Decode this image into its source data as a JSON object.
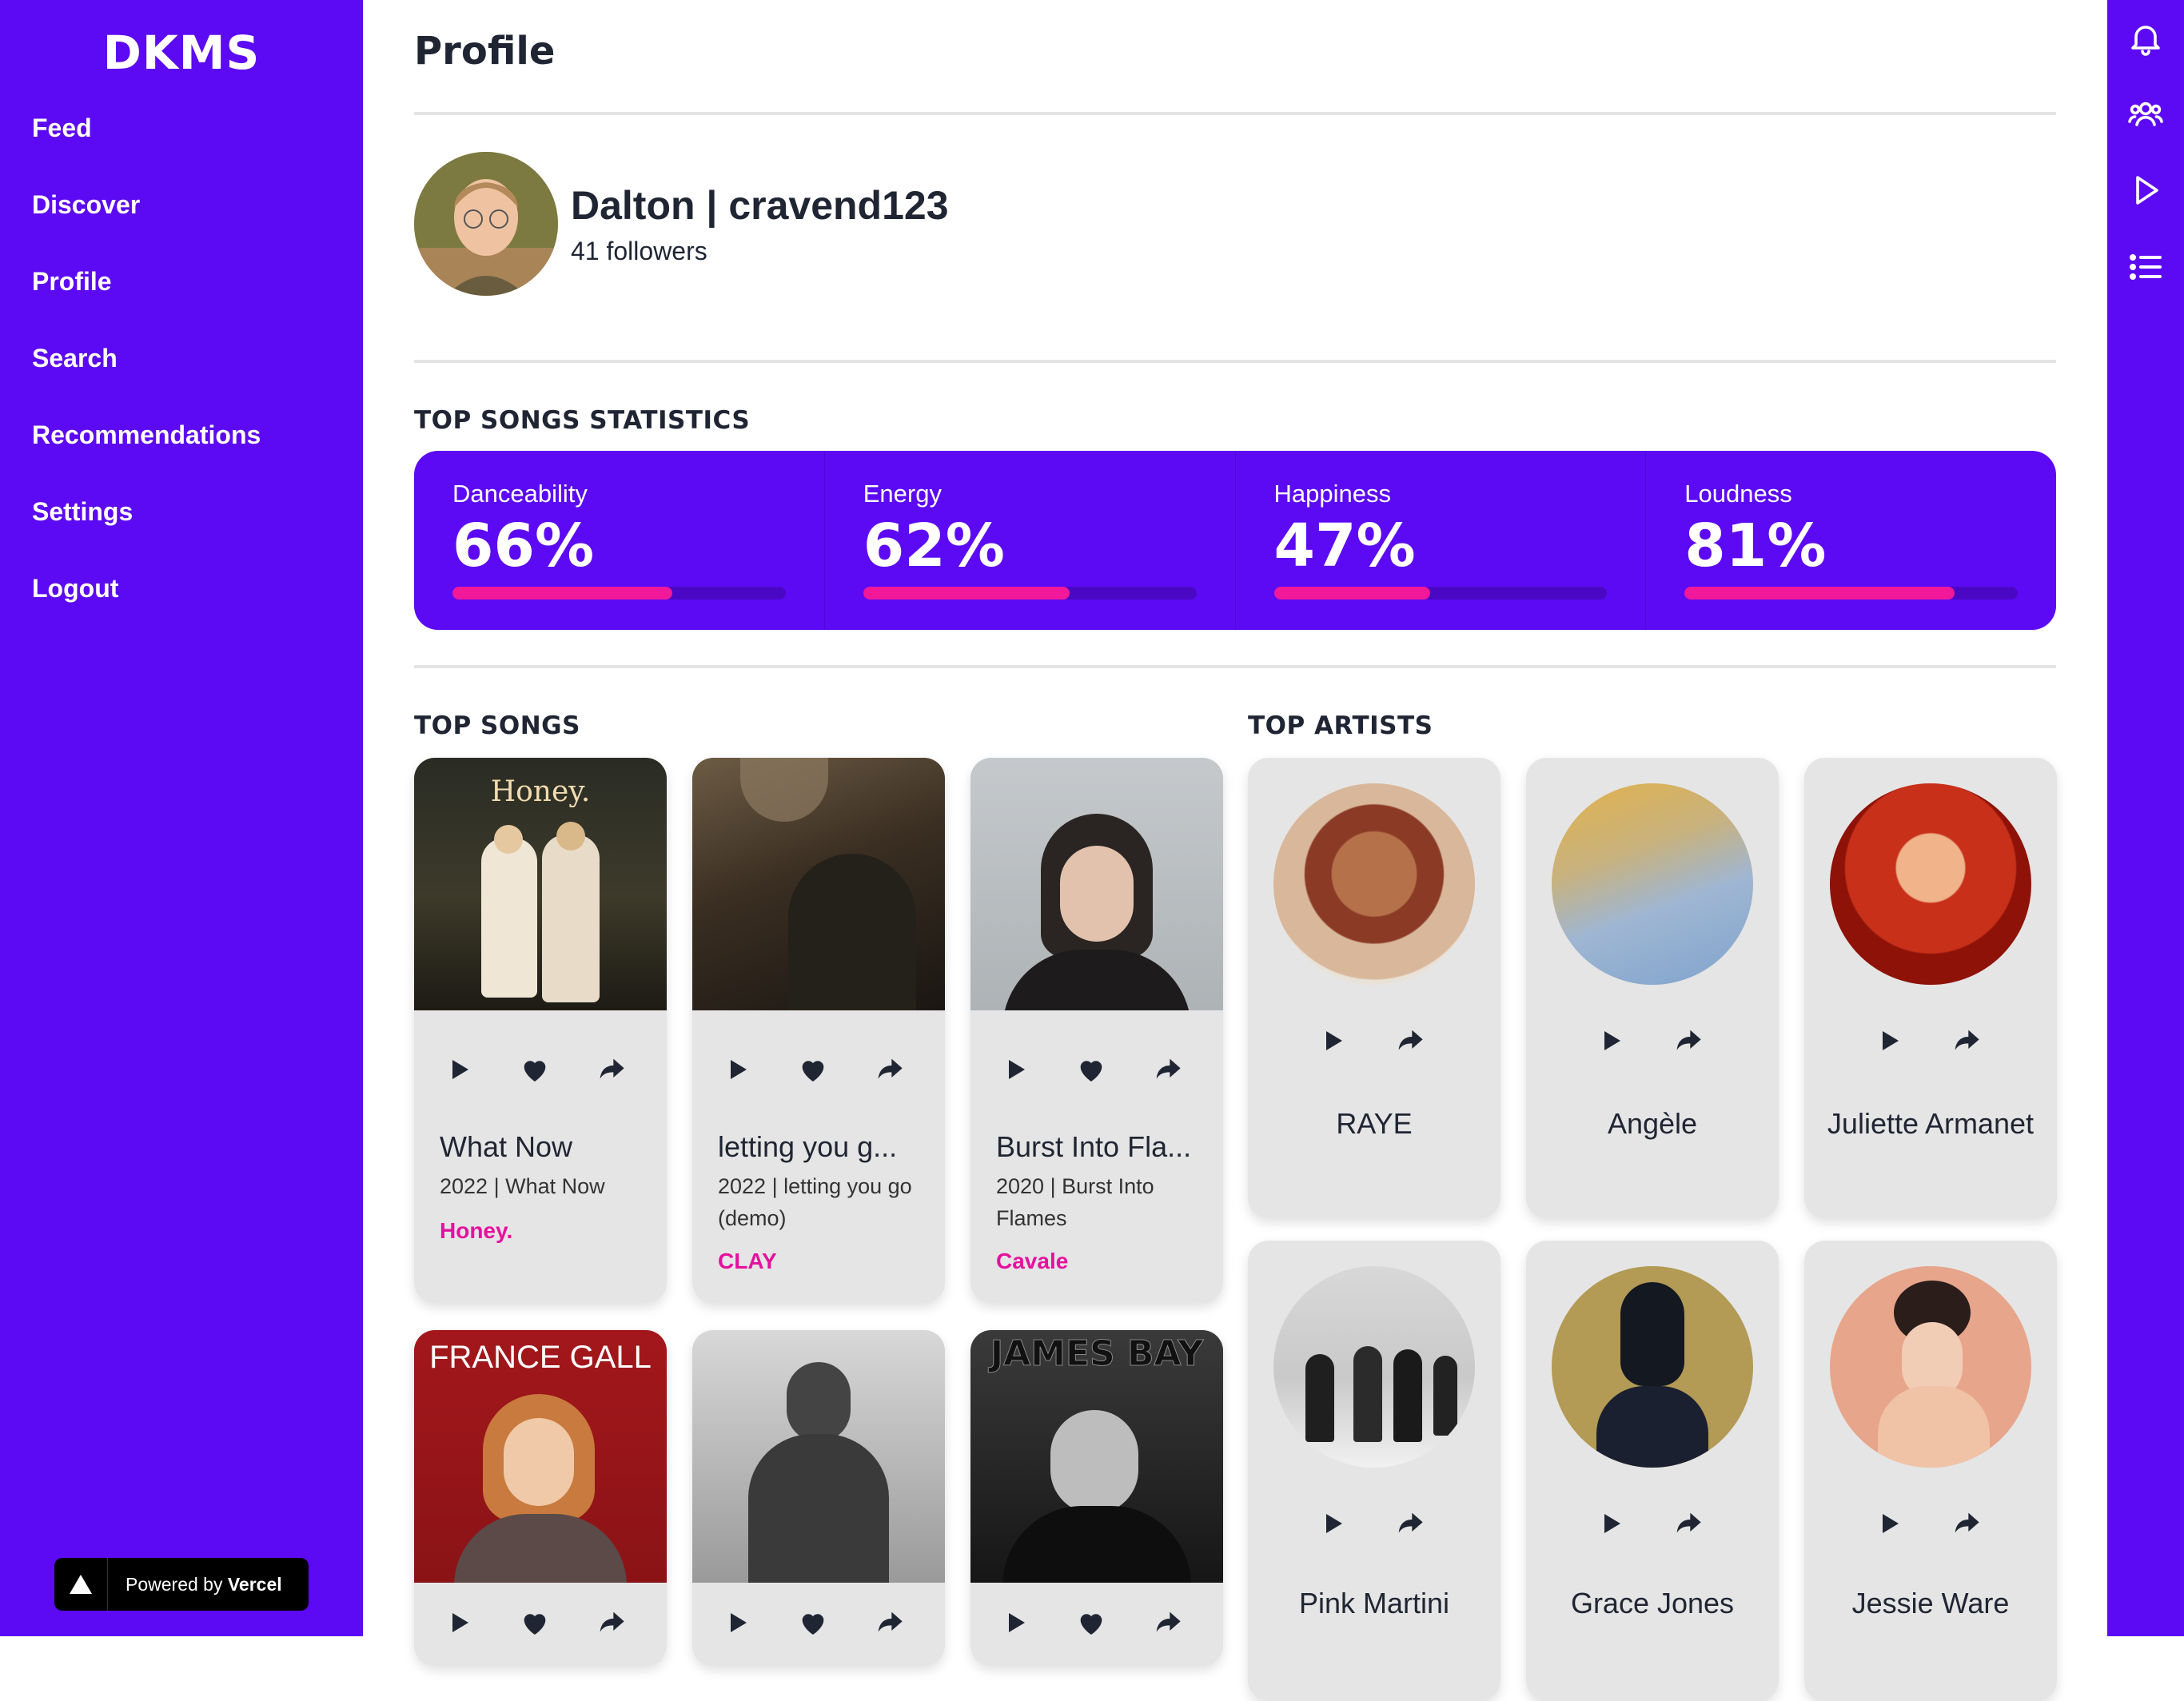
{
  "app": {
    "logo": "DKMS"
  },
  "sidebar": {
    "items": [
      {
        "label": "Feed"
      },
      {
        "label": "Discover"
      },
      {
        "label": "Profile"
      },
      {
        "label": "Search"
      },
      {
        "label": "Recommendations"
      },
      {
        "label": "Settings"
      },
      {
        "label": "Logout"
      }
    ],
    "footer": {
      "powered_by": "Powered by",
      "brand": "Vercel"
    }
  },
  "rail": {
    "icons": [
      "bell-icon",
      "users-icon",
      "play-icon",
      "list-icon"
    ]
  },
  "page": {
    "title": "Profile"
  },
  "profile": {
    "name": "Dalton | cravend123",
    "followers": "41 followers"
  },
  "stats": {
    "title": "TOP SONGS STATISTICS",
    "items": [
      {
        "label": "Danceability",
        "value": "66%",
        "percent": 66
      },
      {
        "label": "Energy",
        "value": "62%",
        "percent": 62
      },
      {
        "label": "Happiness",
        "value": "47%",
        "percent": 47
      },
      {
        "label": "Loudness",
        "value": "81%",
        "percent": 81
      }
    ]
  },
  "top_songs": {
    "title": "TOP SONGS",
    "items": [
      {
        "title": "What Now",
        "sub": "2022 | What Now",
        "artist": "Honey.",
        "cover_text": "Honey."
      },
      {
        "title": "letting you g...",
        "sub": "2022 | letting you go (demo)",
        "artist": "CLAY",
        "cover_text": ""
      },
      {
        "title": "Burst Into Fla...",
        "sub": "2020 | Burst Into Flames",
        "artist": "Cavale",
        "cover_text": ""
      },
      {
        "title": "",
        "sub": "",
        "artist": "",
        "cover_text": "FRANCE GALL"
      },
      {
        "title": "",
        "sub": "",
        "artist": "",
        "cover_text": ""
      },
      {
        "title": "",
        "sub": "",
        "artist": "",
        "cover_text": "JAMES BAY"
      }
    ]
  },
  "top_artists": {
    "title": "TOP ARTISTS",
    "items": [
      {
        "name": "RAYE"
      },
      {
        "name": "Angèle"
      },
      {
        "name": "Juliette Armanet"
      },
      {
        "name": "Pink Martini"
      },
      {
        "name": "Grace Jones"
      },
      {
        "name": "Jessie Ware"
      }
    ]
  },
  "colors": {
    "brand": "#5c0af4",
    "accent": "#f2189a",
    "artist_text": "#e5119e",
    "card_bg": "#e5e5e5"
  }
}
